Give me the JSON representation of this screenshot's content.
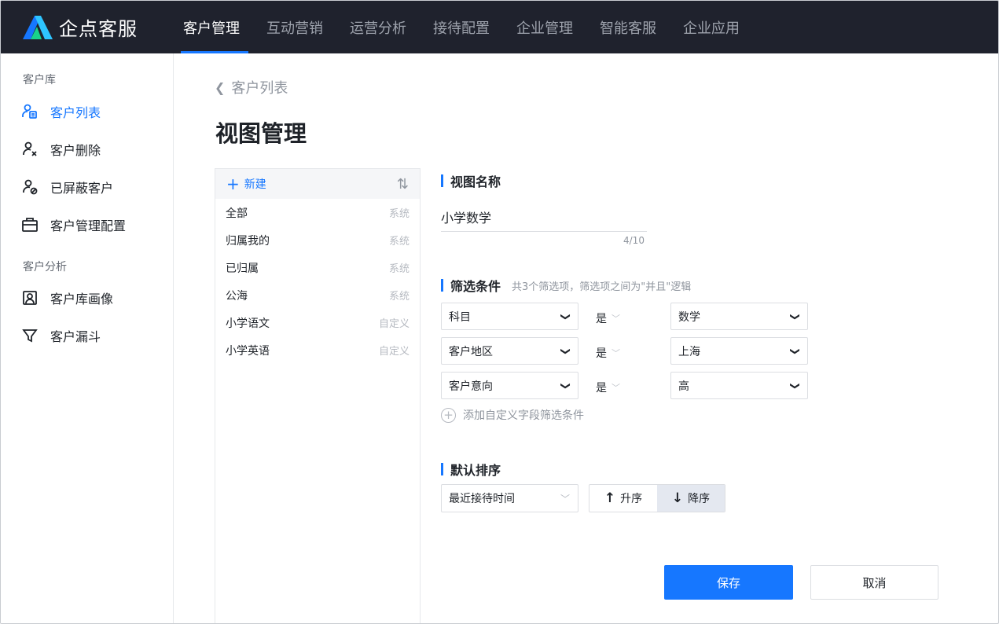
{
  "app": {
    "brand": "企点客服",
    "nav": [
      "客户管理",
      "互动营销",
      "运营分析",
      "接待配置",
      "企业管理",
      "智能客服",
      "企业应用"
    ],
    "active_nav": "客户管理"
  },
  "sidebar": {
    "group1": "客户库",
    "items1": [
      {
        "label": "客户列表",
        "icon": "customer-list-icon"
      },
      {
        "label": "客户删除",
        "icon": "user-remove-icon"
      },
      {
        "label": "已屏蔽客户",
        "icon": "user-block-icon"
      },
      {
        "label": "客户管理配置",
        "icon": "briefcase-icon"
      }
    ],
    "group2": "客户分析",
    "items2": [
      {
        "label": "客户库画像",
        "icon": "portrait-icon"
      },
      {
        "label": "客户漏斗",
        "icon": "funnel-icon"
      }
    ]
  },
  "main": {
    "breadcrumb": "客户列表",
    "title": "视图管理"
  },
  "views": {
    "new_label": "新建",
    "items": [
      {
        "name": "全部",
        "tag": "系统"
      },
      {
        "name": "归属我的",
        "tag": "系统"
      },
      {
        "name": "已归属",
        "tag": "系统"
      },
      {
        "name": "公海",
        "tag": "系统"
      },
      {
        "name": "小学语文",
        "tag": "自定义"
      },
      {
        "name": "小学英语",
        "tag": "自定义"
      }
    ]
  },
  "form": {
    "name_section": "视图名称",
    "name_value": "小学数学",
    "name_count": "4/10",
    "filter_section": "筛选条件",
    "filter_hint": "共3个筛选项，筛选项之间为\"并且\"逻辑",
    "filters": [
      {
        "field": "科目",
        "op": "是",
        "value": "数学"
      },
      {
        "field": "客户地区",
        "op": "是",
        "value": "上海"
      },
      {
        "field": "客户意向",
        "op": "是",
        "value": "高"
      }
    ],
    "add_filter": "添加自定义字段筛选条件",
    "sort_section": "默认排序",
    "sort_field": "最近接待时间",
    "asc": "升序",
    "desc": "降序",
    "sort_order": "desc",
    "save": "保存",
    "cancel": "取消"
  },
  "colors": {
    "accent": "#1677ff",
    "topbar": "#1f222d"
  }
}
